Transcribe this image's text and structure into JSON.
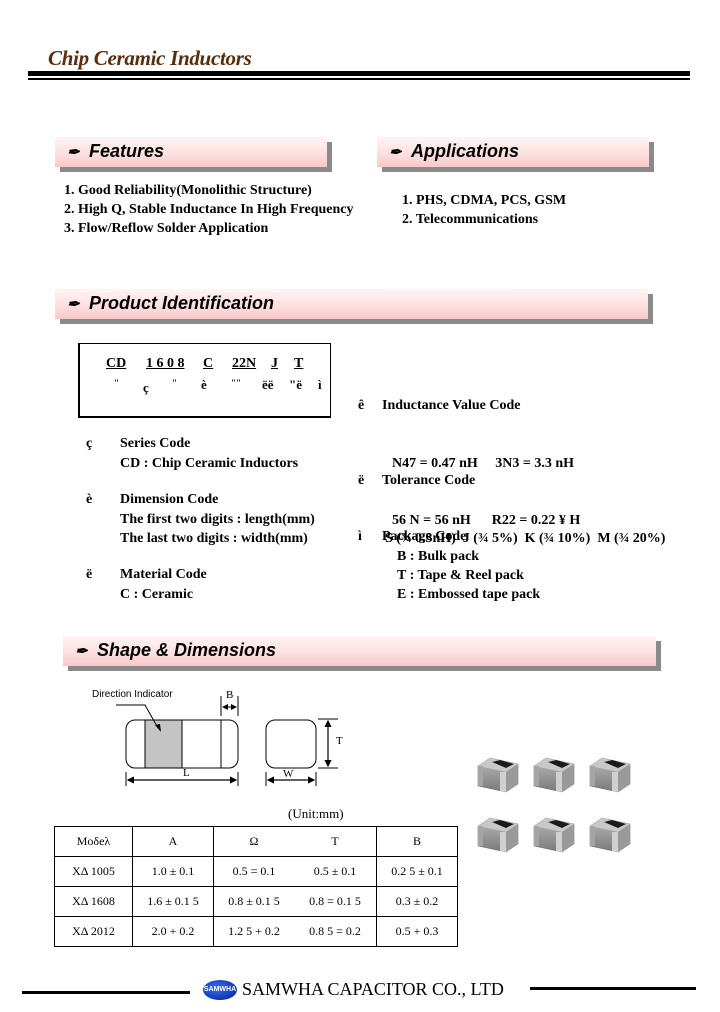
{
  "header": {
    "title": "Chip Ceramic Inductors"
  },
  "features": {
    "heading": "Features",
    "icon": "pen-nib-icon",
    "items": [
      "1. Good Reliability(Monolithic Structure)",
      "2. High Q, Stable Inductance In High Frequency",
      "3. Flow/Reflow Solder Application"
    ]
  },
  "applications": {
    "heading": "Applications",
    "icon": "pen-nib-icon",
    "items": [
      "1. PHS, CDMA, PCS, GSM",
      "2. Telecommunications"
    ]
  },
  "product_identification": {
    "heading": "Product  Identification",
    "icon": "pen-nib-icon",
    "code_parts": [
      "CD",
      "1 6 0 8",
      "C",
      "22N",
      "J",
      "T"
    ],
    "markers": [
      "\"",
      "ç",
      "\"",
      "è",
      "\"\"",
      "ëë",
      "\"ë",
      "ì"
    ],
    "left_items": [
      {
        "bullet": "ç",
        "title": "Series Code",
        "lines": [
          "CD : Chip Ceramic Inductors"
        ]
      },
      {
        "bullet": "è",
        "title": "Dimension Code",
        "lines": [
          "The first two digits : length(mm)",
          "The  last two digits : width(mm)"
        ]
      },
      {
        "bullet": "ë",
        "title": "Material Code",
        "lines": [
          " C : Ceramic"
        ]
      }
    ],
    "right_items": [
      {
        "bullet": "ê",
        "title": "Inductance Value Code",
        "lines": [
          "N47 = 0.47 nH     3N3 = 3.3 nH",
          "56 N = 56 nH      R22 = 0.22 ¥ H"
        ]
      },
      {
        "bullet": "ë",
        "title": "Tolerance Code",
        "lines": [
          "S (¾ 0.3nH)  J (¾ 5%)  K (¾ 10%)  M (¾ 20%)"
        ]
      },
      {
        "bullet": "ì",
        "title": "Package Code",
        "lines": [
          "B : Bulk pack",
          "T : Tape & Reel pack",
          "E : Embossed tape pack"
        ]
      }
    ]
  },
  "shape_dimensions": {
    "heading": "Shape & Dimensions",
    "icon": "pen-nib-icon",
    "diagram_labels": {
      "direction_indicator": "Direction Indicator",
      "B": "B",
      "L": "L",
      "T": "T",
      "W": "W"
    },
    "unit": "(Unit:mm)",
    "table": {
      "headers": [
        "Moδeλ",
        "A",
        "Ω",
        "T",
        "B"
      ],
      "rows": [
        [
          "XΔ 1005",
          "1.0  ± 0.1",
          "0.5  = 0.1",
          "0.5  ± 0.1",
          "0.2 5 ± 0.1"
        ],
        [
          "XΔ 1608",
          "1.6  ± 0.1 5",
          "0.8  ± 0.1 5",
          "0.8  = 0.1 5",
          "0.3  ± 0.2"
        ],
        [
          "XΔ 2012",
          "2.0  + 0.2",
          "1.2 5 + 0.2",
          "0.8 5 = 0.2",
          "0.5  + 0.3"
        ]
      ]
    }
  },
  "footer": {
    "logo_text": "SAMWHA",
    "company": "SAMWHA CAPACITOR CO., LTD"
  }
}
